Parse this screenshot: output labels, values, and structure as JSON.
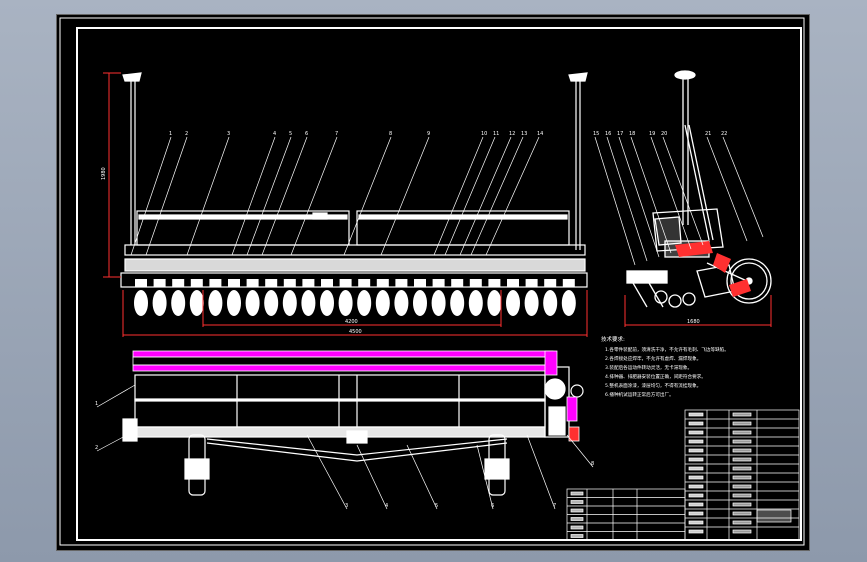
{
  "drawing": {
    "dimensions": {
      "height_left": "1980",
      "width_inner": "4200",
      "width_total": "4500",
      "width_side": "1680"
    },
    "callouts_top": [
      "1",
      "2",
      "3",
      "4",
      "5",
      "6",
      "7",
      "8",
      "9",
      "10",
      "11",
      "12",
      "13",
      "14"
    ],
    "callouts_side": [
      "15",
      "16",
      "17",
      "18",
      "19",
      "20",
      "21",
      "22"
    ],
    "callouts_bottom": [
      "1",
      "2",
      "3",
      "4",
      "5",
      "6",
      "7",
      "8"
    ],
    "notes_title": "技术要求:",
    "notes": [
      "1.各零件装配前，须清洗干净，不允许有毛刺、飞边等缺陷。",
      "2.各焊接处应焊牢，不允许有虚焊、漏焊现象。",
      "3.装配后各运动件转动灵活，无卡滞现象。",
      "4.排种器、排肥器安装位置正确，间距符合要求。",
      "5.整机表面涂漆，漆层均匀，不得有流挂现象。",
      "6.播种机试运转正常后方可出厂。"
    ]
  },
  "colors": {
    "line": "#ffffff",
    "highlight": "#ff00ff",
    "accent": "#ff3030",
    "background": "#000000"
  }
}
